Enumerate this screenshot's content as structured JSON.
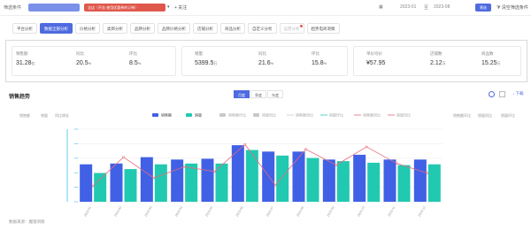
{
  "filter": {
    "label": "筛选条件",
    "tag": "全店（不含 使用优惠券的订单）",
    "follow": "+ 关注",
    "date_start": "2023-01",
    "date_sep": "至",
    "date_end": "2023-08",
    "query": "筛选",
    "clear": "清空筛选条件"
  },
  "tabs": [
    {
      "label": "平台分析",
      "state": "normal"
    },
    {
      "label": "数据全部分析",
      "state": "active"
    },
    {
      "label": "价格分析",
      "state": "normal"
    },
    {
      "label": "类目分析",
      "state": "normal"
    },
    {
      "label": "品牌分析",
      "state": "normal"
    },
    {
      "label": "品牌价格分析",
      "state": "normal"
    },
    {
      "label": "店铺分析",
      "state": "normal"
    },
    {
      "label": "商品分析",
      "state": "normal"
    },
    {
      "label": "自定义分析",
      "state": "normal"
    },
    {
      "label": "运营分析",
      "state": "dim"
    },
    {
      "label": "趋势电商洞察",
      "state": "normal"
    }
  ],
  "kpi": {
    "group1": [
      {
        "label": "销售额",
        "value": "31.28",
        "unit": "亿"
      },
      {
        "label": "同比",
        "value": "20.5",
        "unit": "%"
      },
      {
        "label": "环比",
        "value": "8.5",
        "unit": "%"
      }
    ],
    "group2": [
      {
        "label": "销量",
        "value": "5399.5",
        "unit": "万"
      },
      {
        "label": "同比",
        "value": "21.6",
        "unit": "%"
      },
      {
        "label": "环比",
        "value": "15.8",
        "unit": "%"
      }
    ],
    "group3": [
      {
        "label": "单价均价",
        "value": "¥57.95",
        "unit": ""
      },
      {
        "label": "店铺数",
        "value": "2.12",
        "unit": "万"
      },
      {
        "label": "商品数",
        "value": "15.25",
        "unit": "万"
      }
    ]
  },
  "chart_panel": {
    "title": "销售趋势",
    "toggles": [
      {
        "label": "月度",
        "active": true
      },
      {
        "label": "季度",
        "active": false
      },
      {
        "label": "年度",
        "active": false
      }
    ],
    "download": "↓ 下载",
    "left_axis_names": [
      "销售额",
      "销量",
      "同比增长"
    ],
    "right_axis_names": [
      "销售额环比",
      "销量同比",
      "销量环比"
    ],
    "footer": "数据来源：魔镜洞察"
  },
  "colors": {
    "primary": "#4f6be0",
    "bar_sales": "#4060e6",
    "bar_volume": "#21c9b0",
    "line": "#e8697a",
    "tag_red": "#e0584c"
  },
  "chart_data": {
    "type": "bar",
    "categories": [
      "2023-01",
      "2023-02",
      "2023-03",
      "2023-04",
      "2023-05",
      "2023-06",
      "2023-07",
      "2023-08",
      "2023-09",
      "2023-10",
      "2023-11",
      "2023-12"
    ],
    "series": [
      {
        "name": "销售额",
        "type": "bar",
        "values": [
          47,
          48,
          56,
          53,
          54,
          71,
          63,
          63,
          53,
          59,
          53,
          53
        ]
      },
      {
        "name": "销量",
        "type": "bar",
        "values": [
          36,
          41,
          47,
          48,
          48,
          65,
          58,
          55,
          51,
          49,
          46,
          47
        ]
      },
      {
        "name": "销售额同比",
        "type": "line",
        "values": [
          20,
          56,
          30,
          44,
          38,
          72,
          21,
          66,
          46,
          69,
          48,
          36
        ]
      }
    ],
    "legend": [
      "销售额",
      "销量",
      "销售额环比",
      "销量同比",
      "销售额同比",
      "销量环比",
      "销售额同比",
      "销量同比"
    ],
    "ylim": [
      0,
      100
    ]
  }
}
